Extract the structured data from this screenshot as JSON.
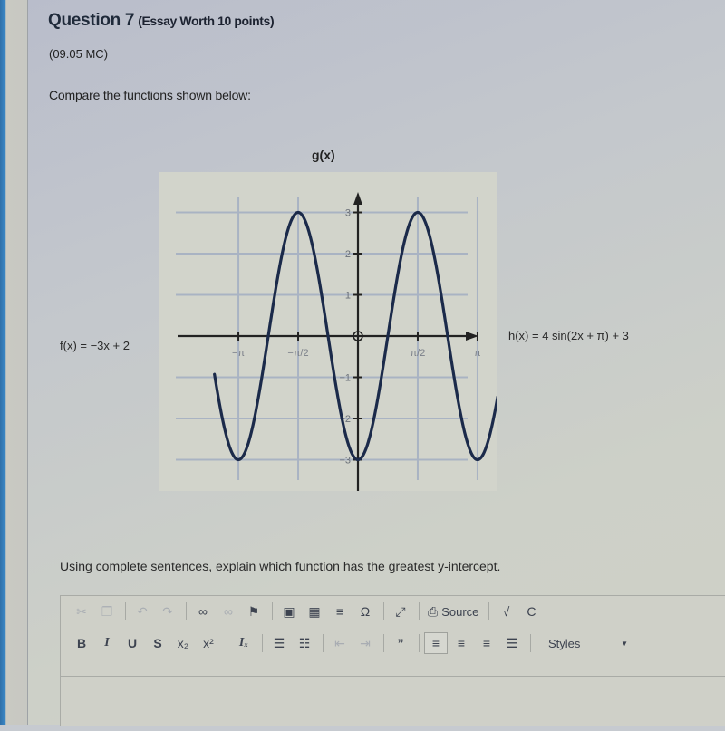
{
  "question": {
    "title": "Question 7",
    "worth": "(Essay Worth 10 points)",
    "code": "(09.05 MC)",
    "prompt": "Compare the functions shown below:",
    "instruction": "Using complete sentences, explain which function has the greatest y-intercept."
  },
  "functions": {
    "f": "f(x) = −3x + 2",
    "h": "h(x) = 4 sin(2x + π) + 3"
  },
  "chart_data": {
    "type": "line",
    "title": "g(x)",
    "xlabel": "",
    "ylabel": "",
    "function": "g(x) = -3cos(2x)",
    "x_domain_approx": [
      -3.77,
      3.67
    ],
    "xlim": [
      -3.8,
      3.8
    ],
    "ylim": [
      -3.6,
      3.6
    ],
    "x_ticks": [
      {
        "value": -3.14159,
        "label": "−π"
      },
      {
        "value": -1.5708,
        "label": "−π/2"
      },
      {
        "value": 1.5708,
        "label": "π/2"
      },
      {
        "value": 3.14159,
        "label": "π"
      }
    ],
    "y_ticks": [
      {
        "value": 3,
        "label": "3"
      },
      {
        "value": 2,
        "label": "2"
      },
      {
        "value": 1,
        "label": "1"
      },
      {
        "value": -1,
        "label": "−1"
      },
      {
        "value": -2,
        "label": "−2"
      },
      {
        "value": -3,
        "label": "−3"
      }
    ],
    "key_points": [
      {
        "x": -3.14159,
        "y": -3
      },
      {
        "x": -1.5708,
        "y": 3
      },
      {
        "x": 0,
        "y": -3
      },
      {
        "x": 1.5708,
        "y": 3
      },
      {
        "x": 3.14159,
        "y": -3
      }
    ],
    "grid": true,
    "line_color": "#1b2a4a"
  },
  "editor": {
    "row1": [
      {
        "icon": "cut-icon",
        "glyph": "✂",
        "disabled": true
      },
      {
        "icon": "copy-icon",
        "glyph": "❐",
        "disabled": true
      },
      {
        "sep": true
      },
      {
        "icon": "undo-icon",
        "glyph": "↶",
        "disabled": true
      },
      {
        "icon": "redo-icon",
        "glyph": "↷",
        "disabled": true
      },
      {
        "sep": true
      },
      {
        "icon": "link-icon",
        "glyph": "∞",
        "disabled": false
      },
      {
        "icon": "unlink-icon",
        "glyph": "∞",
        "disabled": true
      },
      {
        "icon": "anchor-flag-icon",
        "glyph": "⚑",
        "disabled": false
      },
      {
        "sep": true
      },
      {
        "icon": "image-icon",
        "glyph": "▣",
        "disabled": false
      },
      {
        "icon": "table-icon",
        "glyph": "▦",
        "disabled": false
      },
      {
        "icon": "horizontal-line-icon",
        "glyph": "≡",
        "disabled": false
      },
      {
        "icon": "special-char-icon",
        "glyph": "Ω",
        "disabled": false
      },
      {
        "sep": true
      },
      {
        "icon": "maximize-icon",
        "glyph": "⤢",
        "disabled": false
      },
      {
        "sep": true
      },
      {
        "icon": "source-icon",
        "glyph": "⎙",
        "label": "Source",
        "disabled": false
      },
      {
        "sep": true
      },
      {
        "icon": "math-sqrt-icon",
        "glyph": "√",
        "disabled": false
      },
      {
        "icon": "chemistry-c-icon",
        "glyph": "C",
        "disabled": false
      }
    ],
    "row2": [
      {
        "icon": "bold-icon",
        "glyph": "B",
        "cls": "b",
        "disabled": false
      },
      {
        "icon": "italic-icon",
        "glyph": "I",
        "cls": "i",
        "disabled": false
      },
      {
        "icon": "underline-icon",
        "glyph": "U",
        "cls": "u",
        "disabled": false
      },
      {
        "icon": "strikethrough-icon",
        "glyph": "S",
        "cls": "s",
        "disabled": false
      },
      {
        "icon": "subscript-icon",
        "glyph": "x₂",
        "disabled": false
      },
      {
        "icon": "superscript-icon",
        "glyph": "x²",
        "disabled": false
      },
      {
        "sep": true
      },
      {
        "icon": "remove-format-icon",
        "glyph": "Iₓ",
        "cls": "i",
        "disabled": false
      },
      {
        "sep": true
      },
      {
        "icon": "numbered-list-icon",
        "glyph": "☰",
        "disabled": false
      },
      {
        "icon": "bulleted-list-icon",
        "glyph": "☷",
        "disabled": false
      },
      {
        "sep": true
      },
      {
        "icon": "outdent-icon",
        "glyph": "⇤",
        "disabled": true
      },
      {
        "icon": "indent-icon",
        "glyph": "⇥",
        "disabled": true
      },
      {
        "sep": true
      },
      {
        "icon": "blockquote-icon",
        "glyph": "”",
        "cls": "b",
        "disabled": false
      },
      {
        "sep": true
      },
      {
        "icon": "align-left-icon",
        "glyph": "≡",
        "disabled": false,
        "active": true
      },
      {
        "icon": "align-center-icon",
        "glyph": "≡",
        "disabled": false
      },
      {
        "icon": "align-right-icon",
        "glyph": "≡",
        "disabled": false
      },
      {
        "icon": "justify-icon",
        "glyph": "☰",
        "disabled": false
      },
      {
        "sep": true
      }
    ],
    "styles_label": "Styles",
    "body_text": ""
  }
}
